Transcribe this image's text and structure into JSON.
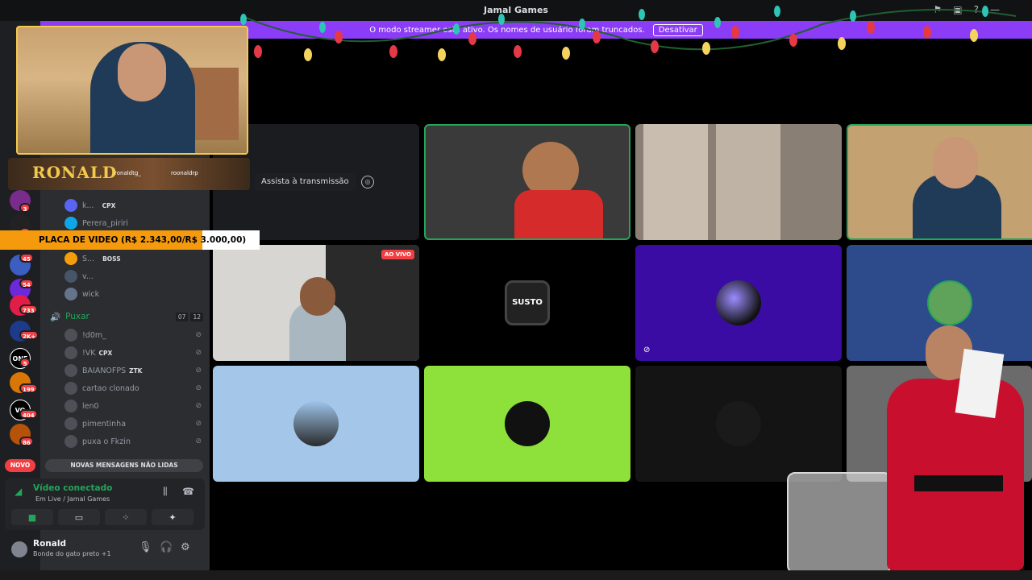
{
  "window": {
    "title": "Jamal Games"
  },
  "banner": {
    "text": "O modo streamer está ativo. Os nomes de usuário foram truncados.",
    "deactivate_label": "Desativar"
  },
  "overlay": {
    "name": "RONALD",
    "social_1": "ronaldtg_",
    "social_2": "roonaldrp",
    "price_text": "PLACA DE VIDEO (R$ 2.343,00/R$ 3.000,00)",
    "price_progress": 0.781
  },
  "rail": {
    "badges": [
      "3",
      "4",
      "45",
      "54",
      "733",
      "2K+",
      "5",
      "199",
      "404",
      "86"
    ]
  },
  "members": [
    {
      "name": "k...",
      "tag": "CPX"
    },
    {
      "name": "Perera_piriri",
      "tag": ""
    },
    {
      "name": "S...",
      "tag": "BOSS"
    },
    {
      "name": "v...",
      "tag": ""
    },
    {
      "name": "wick",
      "tag": ""
    }
  ],
  "voice_channel": {
    "name": "Puxar",
    "count_current": "07",
    "count_max": "12",
    "users": [
      {
        "name": "!d0m_",
        "tag": ""
      },
      {
        "name": "!VK",
        "tag": "CPX"
      },
      {
        "name": "BAIANOFPS",
        "tag": "ZTK"
      },
      {
        "name": "cartao clonado",
        "tag": ""
      },
      {
        "name": "len0",
        "tag": ""
      },
      {
        "name": "pimentinha",
        "tag": ""
      },
      {
        "name": "puxa o Fkzin",
        "tag": ""
      }
    ]
  },
  "unread": {
    "novo": "NOVO",
    "label": "NOVAS MENSAGENS NÃO LIDAS"
  },
  "voice_panel": {
    "title": "Vídeo conectado",
    "subtitle": "Em Live / Jamal Games"
  },
  "user": {
    "name": "Ronald",
    "status": "Bonde do gato preto +1"
  },
  "stage": {
    "watch_label": "Assista à transmissão",
    "live_label": "AO VIVO",
    "susto_label": "SUSTO"
  },
  "colors": {
    "accent": "#8b3cf6",
    "green": "#23a55a",
    "red": "#f23f43",
    "tile_purple": "#3a0ca3",
    "tile_blue": "#2d4a8a",
    "tile_lightblue": "#a4c6e8",
    "tile_lime": "#8ee03a"
  }
}
